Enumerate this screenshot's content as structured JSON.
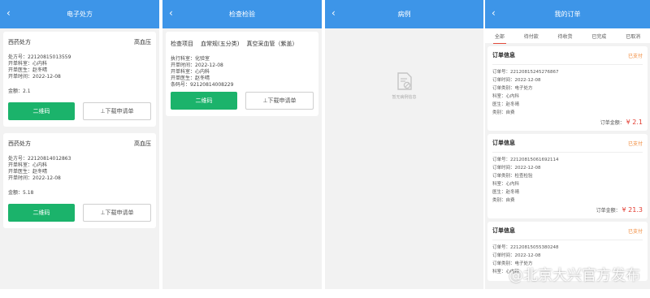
{
  "panel1": {
    "title": "电子处方",
    "cards": [
      {
        "name": "西药处方",
        "diagnosis": "高血压",
        "lines": [
          "处方号：22120815013559",
          "开单科室：心内科",
          "开单医生：赵冬晴",
          "开单时间：2022-12-08"
        ],
        "amount": "金额：2.1",
        "qr_label": "二维码",
        "download_label": "⊥下载申请单"
      },
      {
        "name": "西药处方",
        "diagnosis": "高血压",
        "lines": [
          "处方号：22120814012863",
          "开单科室：心内科",
          "开单医生：赵冬晴",
          "开单时间：2022-12-08"
        ],
        "amount": "金额：5.18",
        "qr_label": "二维码",
        "download_label": "⊥下载申请单"
      }
    ]
  },
  "panel2": {
    "title": "检查检验",
    "card": {
      "item_label": "检查项目",
      "item1": "血常规(五分类)",
      "item2": "真空采血管（紫盖）",
      "lines": [
        "执行科室：化验室",
        "开单时间：2022-12-08",
        "开单科室：心内科",
        "开单医生：赵冬晴",
        "条码号：92120814008229"
      ],
      "qr_label": "二维码",
      "download_label": "⊥下载申请单"
    }
  },
  "panel3": {
    "title": "病例",
    "empty_text": "暂无病例信息"
  },
  "panel4": {
    "title": "我的订单",
    "tabs": [
      "全部",
      "待付款",
      "待收货",
      "已完成",
      "已取消"
    ],
    "orders": [
      {
        "title": "订单信息",
        "status": "已支付",
        "lines": [
          "订单号：22120815245276867",
          "订单时间：2022-12-08",
          "订单类别：电子处方",
          "科室：心内科",
          "医生：赵冬晴",
          "类别：自费"
        ],
        "total_label": "订单金额：",
        "total_value": "¥ 2.1"
      },
      {
        "title": "订单信息",
        "status": "已支付",
        "lines": [
          "订单号：22120815061692114",
          "订单时间：2022-12-08",
          "订单类别：检查检验",
          "科室：心内科",
          "医生：赵冬晴",
          "类别：自费"
        ],
        "total_label": "订单金额：",
        "total_value": "¥ 21.3"
      },
      {
        "title": "订单信息",
        "status": "已支付",
        "lines": [
          "订单号：22120815055380248",
          "订单时间：2022-12-08",
          "订单类别：电子处方",
          "科室：心内科"
        ],
        "total_label": "",
        "total_value": ""
      }
    ]
  },
  "watermark": "@北京大兴官方发布",
  "colors": {
    "header": "#3d95e8",
    "qr_button": "#1bb36b",
    "status": "#f08a3a",
    "money": "#e23b30"
  }
}
